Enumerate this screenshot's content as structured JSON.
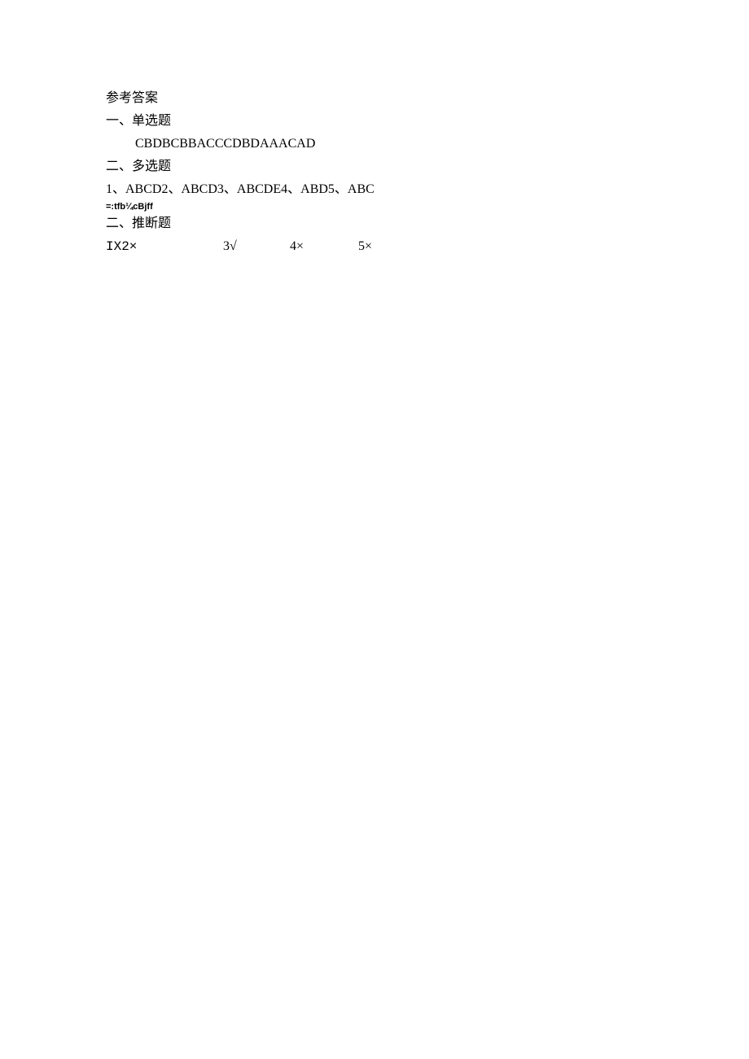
{
  "title": "参考答案",
  "sections": {
    "one": {
      "heading": "一、单选题",
      "answers": "CBDBCBBACCCDBDAAACAD"
    },
    "two": {
      "heading": "二、多选题",
      "answers": "1、ABCD2、ABCD3、ABCDE4、ABD5、ABC"
    },
    "garbled": "=:tfb¼cBjff",
    "three": {
      "heading": "二、推断题",
      "items": {
        "i1": "IX2×",
        "i2": "3√",
        "i3": "4×",
        "i4": "5×"
      }
    }
  }
}
